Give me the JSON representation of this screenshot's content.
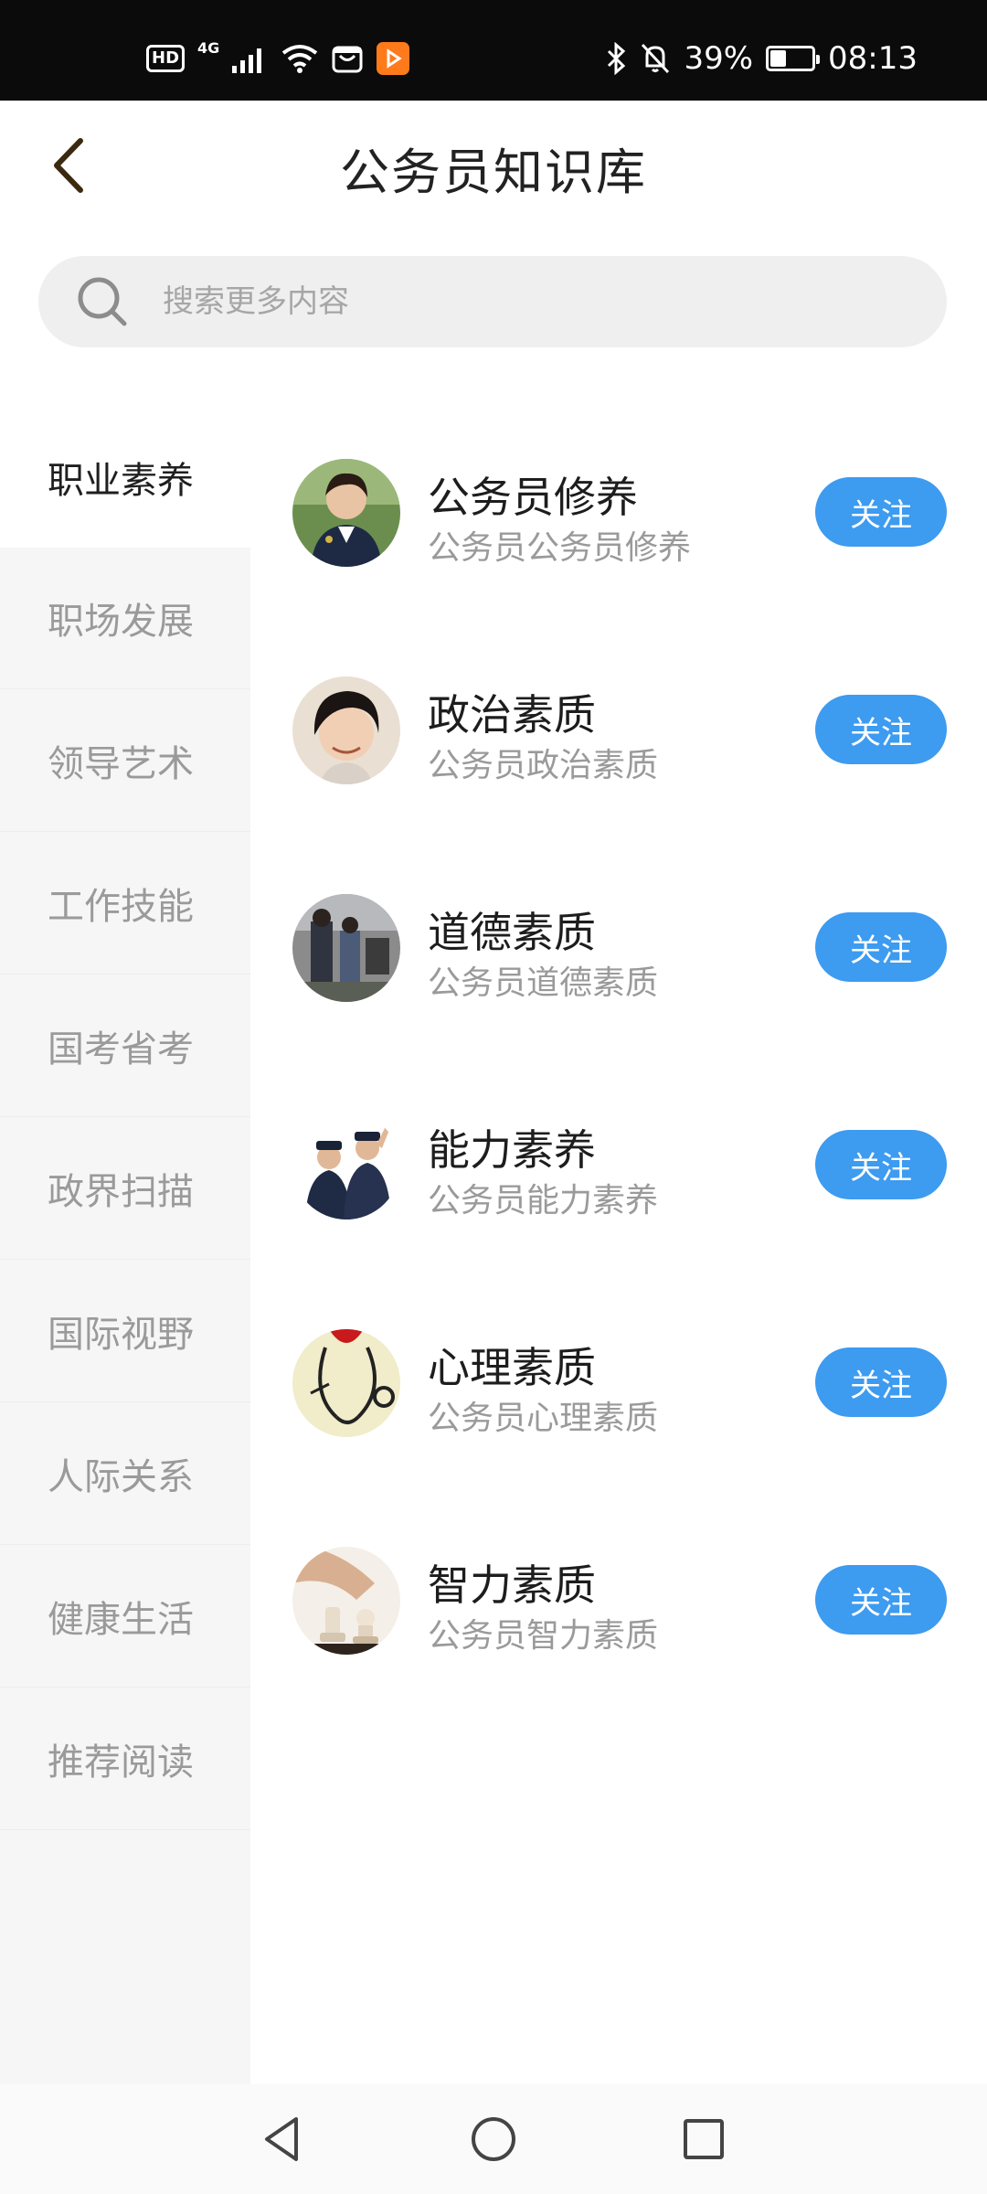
{
  "status_bar": {
    "hd": "HD",
    "network": "4G",
    "battery_percent": "39%",
    "battery_level": 0.39,
    "time": "08:13",
    "icons": [
      "hd-icon",
      "signal-icon",
      "wifi-icon",
      "shopping-app-icon",
      "video-app-icon",
      "bluetooth-icon",
      "mute-icon",
      "battery-icon"
    ]
  },
  "header": {
    "title": "公务员知识库",
    "back_icon": "chevron-left-icon"
  },
  "search": {
    "placeholder": "搜索更多内容",
    "icon": "search-icon"
  },
  "sidebar": {
    "items": [
      {
        "label": "职业素养",
        "active": true
      },
      {
        "label": "职场发展",
        "active": false
      },
      {
        "label": "领导艺术",
        "active": false
      },
      {
        "label": "工作技能",
        "active": false
      },
      {
        "label": "国考省考",
        "active": false
      },
      {
        "label": "政界扫描",
        "active": false
      },
      {
        "label": "国际视野",
        "active": false
      },
      {
        "label": "人际关系",
        "active": false
      },
      {
        "label": "健康生活",
        "active": false
      },
      {
        "label": "推荐阅读",
        "active": false
      }
    ]
  },
  "topics": [
    {
      "title": "公务员修养",
      "subtitle": "公务员公务员修养",
      "button": "关注"
    },
    {
      "title": "政治素质",
      "subtitle": "公务员政治素质",
      "button": "关注"
    },
    {
      "title": "道德素质",
      "subtitle": "公务员道德素质",
      "button": "关注"
    },
    {
      "title": "能力素养",
      "subtitle": "公务员能力素养",
      "button": "关注"
    },
    {
      "title": "心理素质",
      "subtitle": "公务员心理素质",
      "button": "关注"
    },
    {
      "title": "智力素质",
      "subtitle": "公务员智力素质",
      "button": "关注"
    }
  ],
  "nav_bar": {
    "icons": [
      "back-triangle-icon",
      "home-circle-icon",
      "recents-square-icon"
    ]
  },
  "colors": {
    "accent": "#3d9bf0",
    "status_bar_bg": "#0b0b0b",
    "sidebar_bg": "#f6f6f6",
    "search_bg": "#efefef"
  }
}
